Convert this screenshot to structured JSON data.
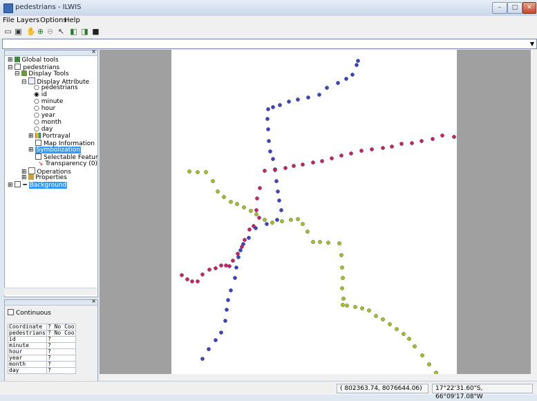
{
  "window": {
    "title": "pedestrians - ILWIS",
    "min_label": "–",
    "max_label": "□",
    "close_label": "✕"
  },
  "menu": [
    "File",
    "Layers",
    "Options",
    "Help"
  ],
  "toolbar": {
    "icons": [
      "new-map-icon",
      "open-icon",
      "pan-icon",
      "zoom-in-icon",
      "zoom-out-icon",
      "pointer-icon",
      "layers-icon",
      "copy-icon",
      "save-icon"
    ]
  },
  "command_line": {
    "value": ""
  },
  "layer_tree": {
    "global_tools": "Global tools",
    "pedestrians": "pedestrians",
    "display_tools": "Display Tools",
    "display_attribute": "Display Attribute",
    "attributes": [
      "pedestrians",
      "id",
      "minute",
      "hour",
      "year",
      "month",
      "day"
    ],
    "portrayal": "Portrayal",
    "map_information": "Map Information",
    "symbolization": "Symbolization",
    "selectable": "Selectable Featur",
    "transparency": "Transparency (0)",
    "operations": "Operations",
    "properties": "Properties",
    "background": "Background"
  },
  "pixel_info": {
    "continuous_label": "Continuous",
    "rows": [
      {
        "name": "Coordinate",
        "value": "? No Coo"
      },
      {
        "name": "pedestrians",
        "value": "? No Coo"
      },
      {
        "name": "id",
        "value": "?"
      },
      {
        "name": "minute",
        "value": "?"
      },
      {
        "name": "hour",
        "value": "?"
      },
      {
        "name": "year",
        "value": "?"
      },
      {
        "name": "month",
        "value": "?"
      },
      {
        "name": "day",
        "value": "?"
      }
    ]
  },
  "colors": {
    "track_blue": "#3b44c4",
    "track_magenta": "#cc1f6a",
    "track_olive": "#a3c21e",
    "map_background": "#a0a0a0"
  },
  "status": {
    "xy": "( 802363.74, 8076644.06)",
    "latlon": "17°22'31.60\"S, 66°09'17.08\"W"
  }
}
